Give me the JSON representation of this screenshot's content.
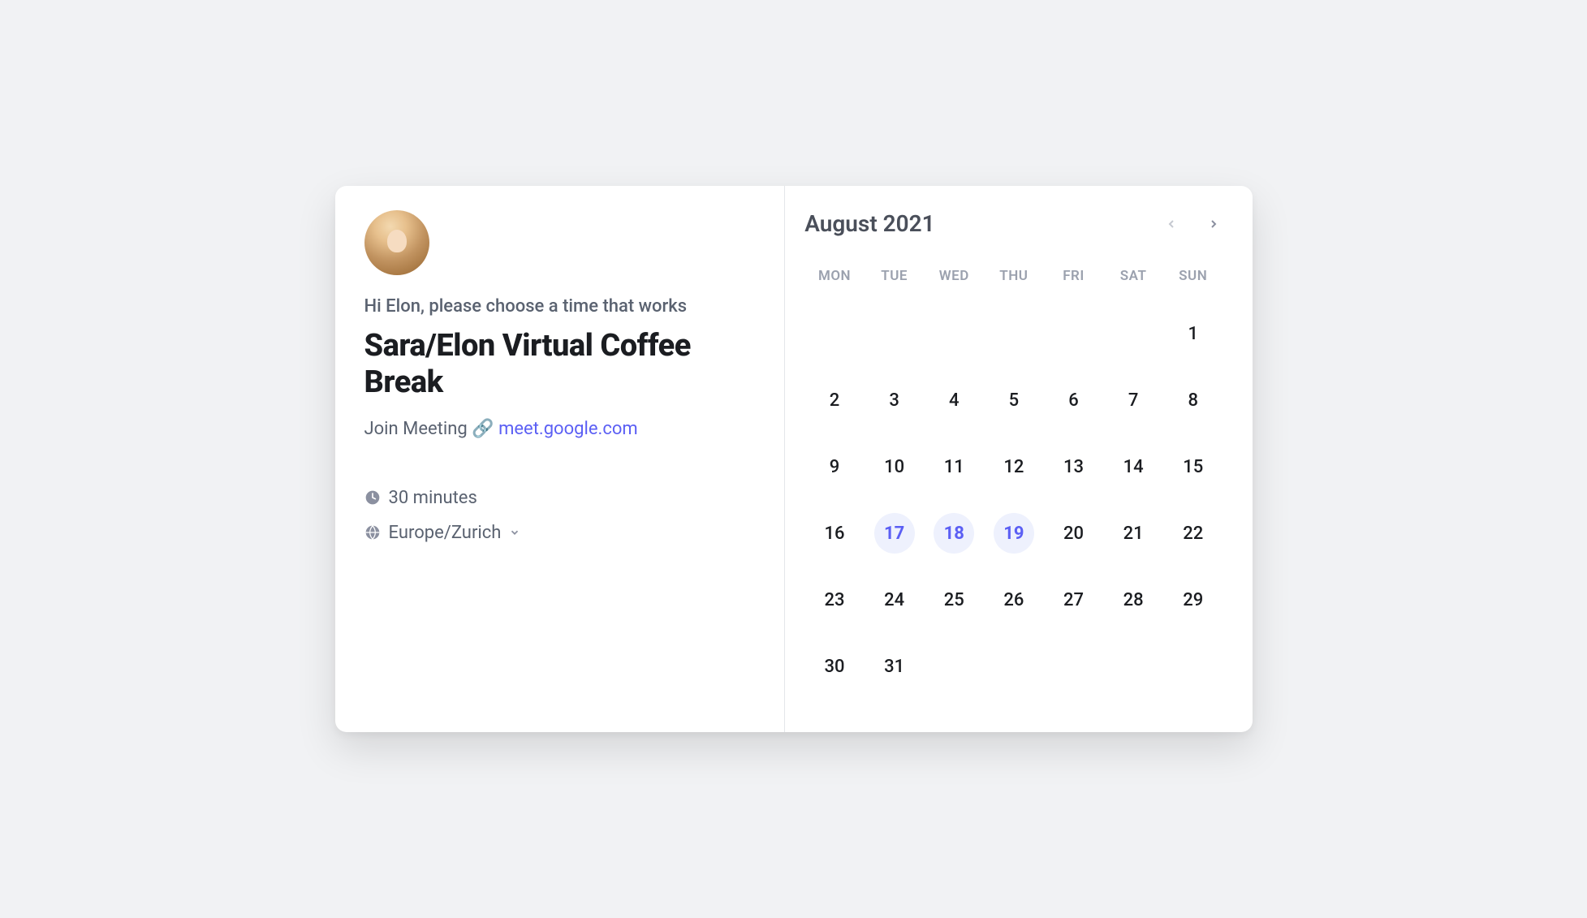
{
  "meeting": {
    "greeting": "Hi Elon, please choose a time that works",
    "title": "Sara/Elon Virtual Coffee Break",
    "join_label": "Join Meeting",
    "link_emoji": "🔗",
    "join_url_text": "meet.google.com",
    "duration": "30 minutes",
    "timezone": "Europe/Zurich"
  },
  "calendar": {
    "month_label": "August 2021",
    "dow": [
      "MON",
      "TUE",
      "WED",
      "THU",
      "FRI",
      "SAT",
      "SUN"
    ],
    "weeks": [
      [
        null,
        null,
        null,
        null,
        null,
        null,
        {
          "n": 1
        }
      ],
      [
        {
          "n": 2
        },
        {
          "n": 3
        },
        {
          "n": 4
        },
        {
          "n": 5
        },
        {
          "n": 6
        },
        {
          "n": 7
        },
        {
          "n": 8
        }
      ],
      [
        {
          "n": 9
        },
        {
          "n": 10
        },
        {
          "n": 11
        },
        {
          "n": 12
        },
        {
          "n": 13
        },
        {
          "n": 14
        },
        {
          "n": 15
        }
      ],
      [
        {
          "n": 16
        },
        {
          "n": 17,
          "available": true
        },
        {
          "n": 18,
          "available": true
        },
        {
          "n": 19,
          "available": true
        },
        {
          "n": 20
        },
        {
          "n": 21
        },
        {
          "n": 22
        }
      ],
      [
        {
          "n": 23
        },
        {
          "n": 24
        },
        {
          "n": 25
        },
        {
          "n": 26
        },
        {
          "n": 27
        },
        {
          "n": 28
        },
        {
          "n": 29
        }
      ],
      [
        {
          "n": 30
        },
        {
          "n": 31
        },
        null,
        null,
        null,
        null,
        null
      ]
    ],
    "prev_disabled": true
  }
}
